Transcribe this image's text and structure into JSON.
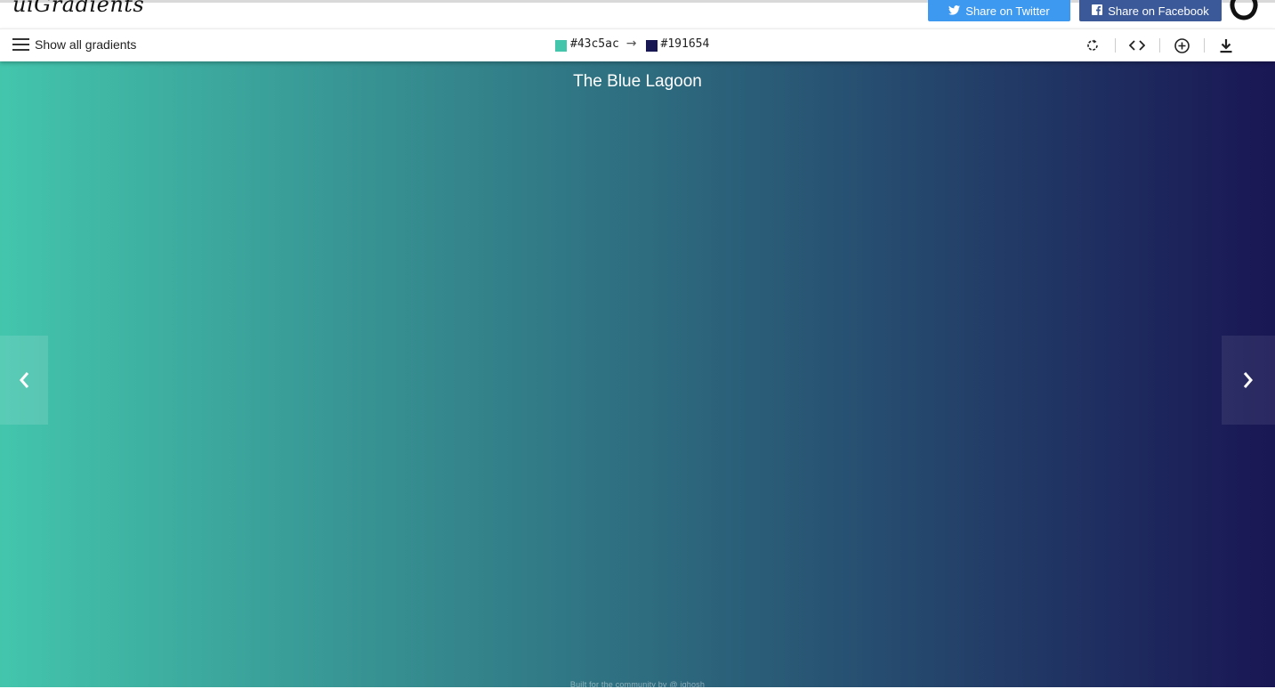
{
  "header": {
    "logo": "uiGradients",
    "twitter_label": "Share on Twitter",
    "facebook_label": "Share on Facebook"
  },
  "toolbar": {
    "menu_label": "Show all gradients",
    "color_from": "#43c5ac",
    "color_to": "#191654",
    "tools": [
      "rotate-icon",
      "code-icon",
      "add-icon",
      "download-icon"
    ]
  },
  "gradient": {
    "name": "The Blue Lagoon",
    "start": "#43c5ac",
    "end": "#191654"
  },
  "footer": {
    "text": "Built for the community by @ ighosh"
  },
  "colors": {
    "twitter": "#3d98f0",
    "facebook": "#3b5998"
  }
}
